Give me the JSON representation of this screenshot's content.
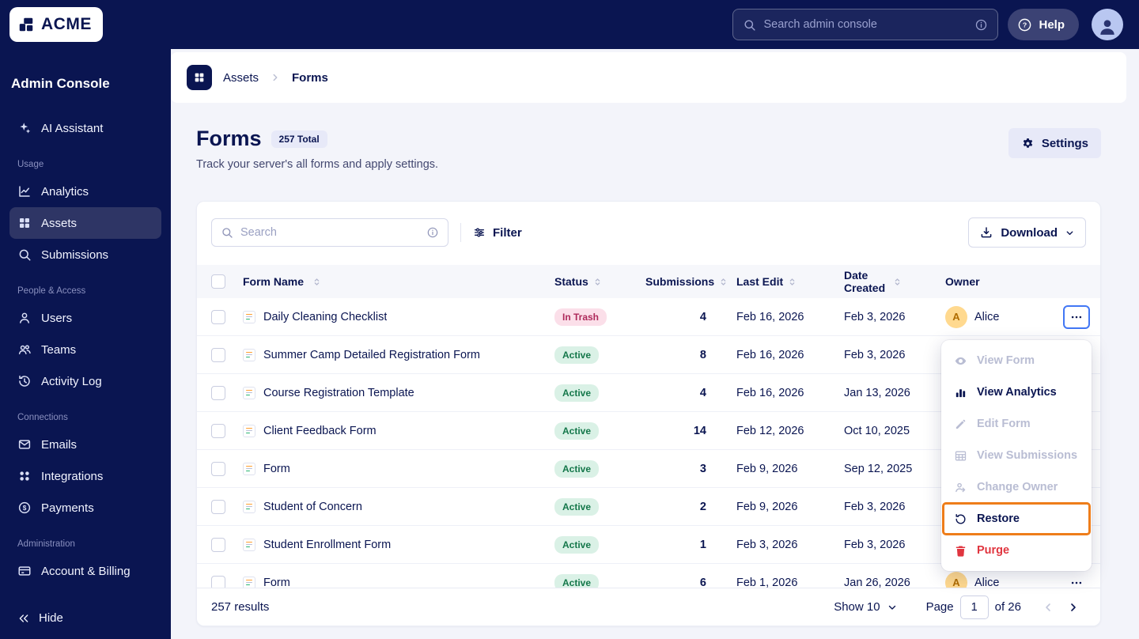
{
  "topbar": {
    "logo": "ACME",
    "search_placeholder": "Search admin console",
    "help_label": "Help"
  },
  "sidebar": {
    "title": "Admin Console",
    "ai_assistant": "AI Assistant",
    "sections": [
      {
        "label": "Usage",
        "items": [
          {
            "label": "Analytics",
            "icon": "analytics-icon",
            "active": false
          },
          {
            "label": "Assets",
            "icon": "assets-icon",
            "active": true
          },
          {
            "label": "Submissions",
            "icon": "search-icon",
            "active": false
          }
        ]
      },
      {
        "label": "People & Access",
        "items": [
          {
            "label": "Users",
            "icon": "user-icon",
            "active": false
          },
          {
            "label": "Teams",
            "icon": "teams-icon",
            "active": false
          },
          {
            "label": "Activity Log",
            "icon": "activity-icon",
            "active": false
          }
        ]
      },
      {
        "label": "Connections",
        "items": [
          {
            "label": "Emails",
            "icon": "email-icon",
            "active": false
          },
          {
            "label": "Integrations",
            "icon": "integrations-icon",
            "active": false
          },
          {
            "label": "Payments",
            "icon": "payments-icon",
            "active": false
          }
        ]
      },
      {
        "label": "Administration",
        "items": [
          {
            "label": "Account & Billing",
            "icon": "billing-icon",
            "active": false
          }
        ]
      }
    ],
    "hide_label": "Hide"
  },
  "breadcrumb": {
    "root": "Assets",
    "current": "Forms"
  },
  "page": {
    "title": "Forms",
    "total_badge": "257 Total",
    "subtitle": "Track your server's all forms and apply settings.",
    "settings_label": "Settings"
  },
  "toolbar": {
    "search_placeholder": "Search",
    "filter_label": "Filter",
    "download_label": "Download"
  },
  "table": {
    "columns": [
      {
        "label": "Form Name",
        "sortable": true
      },
      {
        "label": "Status",
        "sortable": true
      },
      {
        "label": "Submissions",
        "sortable": true
      },
      {
        "label": "Last Edit",
        "sortable": true
      },
      {
        "label": "Date Created",
        "sortable": true
      },
      {
        "label": "Owner",
        "sortable": false
      }
    ],
    "rows": [
      {
        "name": "Daily Cleaning Checklist",
        "status": "In Trash",
        "status_type": "trash",
        "submissions": "4",
        "last_edit": "Feb 16, 2026",
        "date_created": "Feb 3, 2026",
        "owner": "Alice",
        "owner_initial": "A",
        "menu_open": true
      },
      {
        "name": "Summer Camp Detailed Registration Form",
        "status": "Active",
        "status_type": "active",
        "submissions": "8",
        "last_edit": "Feb 16, 2026",
        "date_created": "Feb 3, 2026",
        "owner": "",
        "owner_initial": "",
        "menu_open": false
      },
      {
        "name": "Course Registration Template",
        "status": "Active",
        "status_type": "active",
        "submissions": "4",
        "last_edit": "Feb 16, 2026",
        "date_created": "Jan 13, 2026",
        "owner": "",
        "owner_initial": "",
        "menu_open": false
      },
      {
        "name": "Client Feedback Form",
        "status": "Active",
        "status_type": "active",
        "submissions": "14",
        "last_edit": "Feb 12, 2026",
        "date_created": "Oct 10, 2025",
        "owner": "",
        "owner_initial": "",
        "menu_open": false
      },
      {
        "name": "Form",
        "status": "Active",
        "status_type": "active",
        "submissions": "3",
        "last_edit": "Feb 9, 2026",
        "date_created": "Sep 12, 2025",
        "owner": "",
        "owner_initial": "",
        "menu_open": false
      },
      {
        "name": "Student of Concern",
        "status": "Active",
        "status_type": "active",
        "submissions": "2",
        "last_edit": "Feb 9, 2026",
        "date_created": "Feb 3, 2026",
        "owner": "",
        "owner_initial": "",
        "menu_open": false
      },
      {
        "name": "Student Enrollment Form",
        "status": "Active",
        "status_type": "active",
        "submissions": "1",
        "last_edit": "Feb 3, 2026",
        "date_created": "Feb 3, 2026",
        "owner": "",
        "owner_initial": "",
        "menu_open": false
      },
      {
        "name": "Form",
        "status": "Active",
        "status_type": "active",
        "submissions": "6",
        "last_edit": "Feb 1, 2026",
        "date_created": "Jan 26, 2026",
        "owner": "Alice",
        "owner_initial": "A",
        "menu_open": false
      }
    ]
  },
  "context_menu": {
    "items": [
      {
        "label": "View Form",
        "icon": "eye-icon",
        "state": "disabled",
        "highlighted": false
      },
      {
        "label": "View Analytics",
        "icon": "analytics-bars-icon",
        "state": "enabled",
        "highlighted": false
      },
      {
        "label": "Edit Form",
        "icon": "pencil-icon",
        "state": "disabled",
        "highlighted": false
      },
      {
        "label": "View Submissions",
        "icon": "table-icon",
        "state": "disabled",
        "highlighted": false
      },
      {
        "label": "Change Owner",
        "icon": "change-owner-icon",
        "state": "disabled",
        "highlighted": false
      },
      {
        "label": "Restore",
        "icon": "restore-icon",
        "state": "enabled",
        "highlighted": true
      },
      {
        "label": "Purge",
        "icon": "trash-icon",
        "state": "danger",
        "highlighted": false
      }
    ]
  },
  "footer": {
    "results": "257 results",
    "show_label": "Show 10",
    "page_label": "Page",
    "page_value": "1",
    "of_label": "of 26"
  },
  "colors": {
    "navy": "#0a1551",
    "highlight_orange": "#ee7d1a",
    "focus_blue": "#4277f5",
    "active_badge_bg": "#daf1e6",
    "active_badge_text": "#14774a",
    "trash_badge_bg": "#fbdfe9",
    "trash_badge_text": "#ae2a5b",
    "danger_red": "#e0353f"
  }
}
